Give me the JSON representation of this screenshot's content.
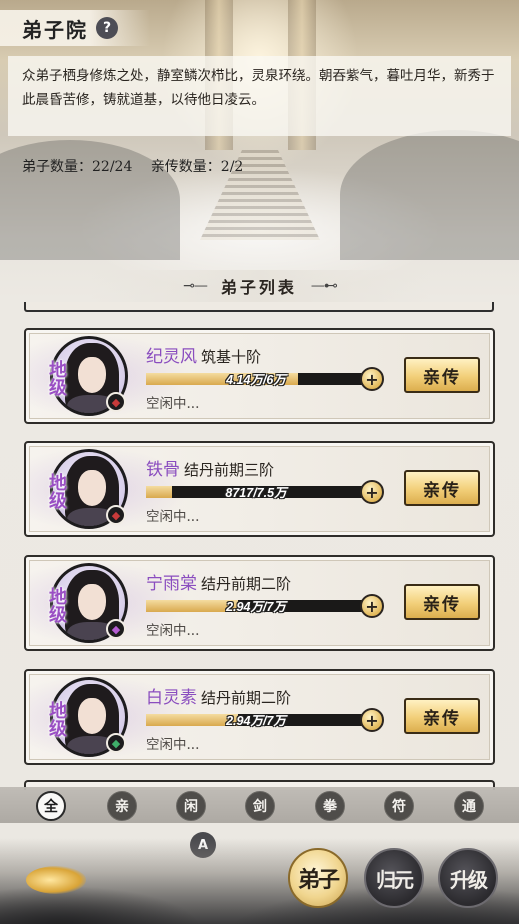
{
  "header": {
    "title": "弟子院",
    "help_label": "?",
    "description": "众弟子栖身修炼之处，静室鳞次栉比，灵泉环绕。朝吞紫气，暮吐月华，新秀于此晨昏苦修，铸就道基，以待他日凌云。",
    "disciple_count": "弟子数量：22/24",
    "core_count": "亲传数量：2/2"
  },
  "list": {
    "title": "弟子列表",
    "deco_left": "⊸—",
    "deco_right": "—⊷"
  },
  "disciples": [
    {
      "name": "纪灵风",
      "realm": "筑基十阶",
      "exp_text": "4.14万/6万",
      "progress": 0.69,
      "status": "空闲中...",
      "grade": "地级",
      "element": "fire",
      "element_color": "#c83a3a",
      "action": "亲传"
    },
    {
      "name": "铁骨",
      "realm": "结丹前期三阶",
      "exp_text": "8717/7.5万",
      "progress": 0.12,
      "status": "空闲中...",
      "grade": "地级",
      "element": "fire",
      "element_color": "#c83a3a",
      "action": "亲传"
    },
    {
      "name": "宁雨棠",
      "realm": "结丹前期二阶",
      "exp_text": "2.94万/7万",
      "progress": 0.42,
      "status": "空闲中...",
      "grade": "地级",
      "element": "wind",
      "element_color": "#b45cd1",
      "action": "亲传"
    },
    {
      "name": "白灵素",
      "realm": "结丹前期二阶",
      "exp_text": "2.94万/7万",
      "progress": 0.42,
      "status": "空闲中...",
      "grade": "地级",
      "element": "wood",
      "element_color": "#3fae6a",
      "action": "亲传"
    }
  ],
  "filters": [
    {
      "label": "全",
      "active": true
    },
    {
      "label": "亲",
      "active": false
    },
    {
      "label": "闲",
      "active": false
    },
    {
      "label": "剑",
      "active": false
    },
    {
      "label": "拳",
      "active": false
    },
    {
      "label": "符",
      "active": false
    },
    {
      "label": "通",
      "active": false
    }
  ],
  "a_button": "A",
  "bottom_nav": [
    {
      "label": "弟子",
      "active": true
    },
    {
      "label": "归元",
      "active": false
    },
    {
      "label": "升级",
      "active": false
    }
  ],
  "plus_label": "+"
}
